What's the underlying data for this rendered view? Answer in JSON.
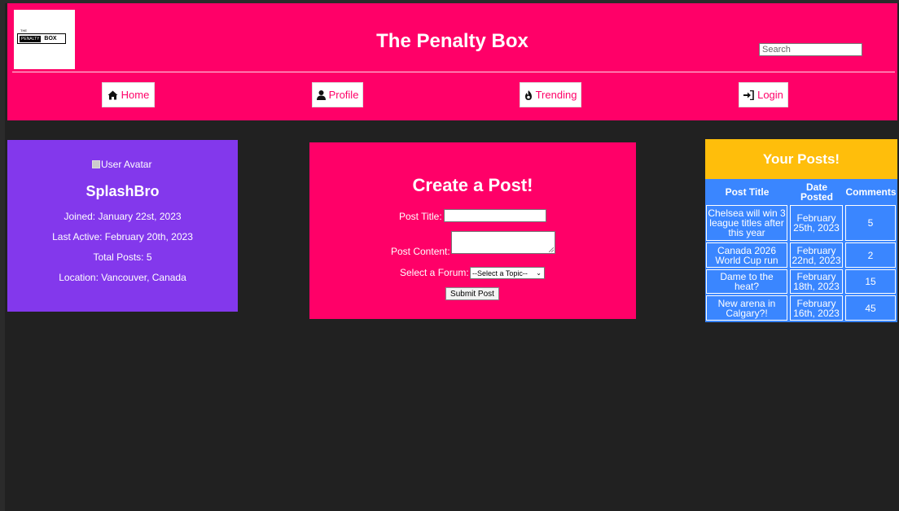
{
  "header": {
    "logo": {
      "small_text": "THE",
      "penalty": "PENALTY",
      "box": "BOX"
    },
    "title": "The Penalty Box",
    "search_placeholder": "Search"
  },
  "nav": {
    "home": "Home",
    "profile": "Profile",
    "trending": "Trending",
    "login": "Login"
  },
  "profile": {
    "avatar_alt": "User Avatar",
    "username": "SplashBro",
    "joined": "Joined: January 22st, 2023",
    "last_active": "Last Active: February 20th, 2023",
    "total_posts": "Total Posts: 5",
    "location": "Location: Vancouver, Canada"
  },
  "create_post": {
    "title": "Create a Post!",
    "post_title_label": "Post Title:",
    "post_content_label": "Post Content:",
    "forum_label": "Select a Forum:",
    "forum_selected": "--Select a Topic--",
    "submit_label": "Submit Post"
  },
  "your_posts": {
    "title": "Your Posts!",
    "columns": [
      "Post Title",
      "Date Posted",
      "Comments"
    ],
    "rows": [
      {
        "title": "Chelsea will win 3 league titles after this year",
        "date": "February 25th, 2023",
        "comments": "5"
      },
      {
        "title": "Canada 2026 World Cup run",
        "date": "February 22nd, 2023",
        "comments": "2"
      },
      {
        "title": "Dame to the heat?",
        "date": "February 18th, 2023",
        "comments": "15"
      },
      {
        "title": "New arena in Calgary?!",
        "date": "February 16th, 2023",
        "comments": "45"
      }
    ]
  },
  "colors": {
    "brand_pink": "#ff0068",
    "profile_purple": "#8338ec",
    "posts_blue": "#3a86ff",
    "posts_header_yellow": "#ffbe0b",
    "background": "#212121"
  },
  "icons": {
    "home": "home-icon",
    "profile": "user-icon",
    "trending": "fire-icon",
    "login": "sign-in-icon"
  }
}
